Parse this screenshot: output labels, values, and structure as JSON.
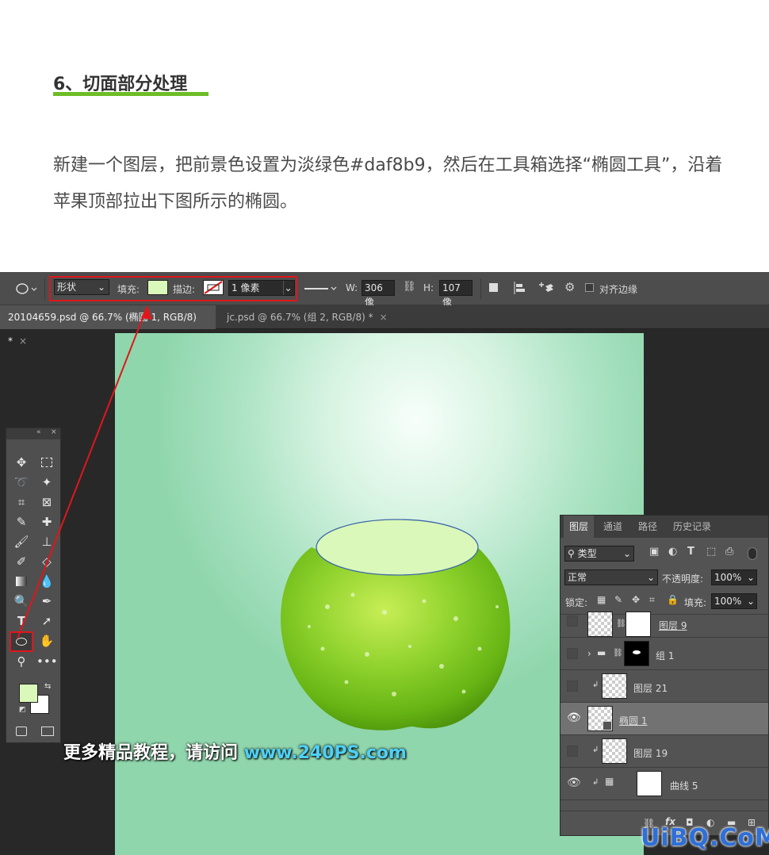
{
  "article": {
    "heading": "6、切面部分处理",
    "paragraph": "新建一个图层，把前景色设置为淡绿色#daf8b9，然后在工具箱选择“椭圆工具”，沿着苹果顶部拉出下图所示的椭圆。"
  },
  "options_bar": {
    "mode_select": "形状",
    "fill_label": "填充:",
    "fill_color": "#daf8b9",
    "stroke_label": "描边:",
    "stroke_width": "1 像素",
    "w_label": "W:",
    "w_value": "306 像",
    "h_label": "H:",
    "h_value": "107 像",
    "align_edges_label": "对齐边缘"
  },
  "tabs": [
    {
      "label": "20104659.psd @ 66.7% (椭圆 1, RGB/8) *",
      "close": "×"
    },
    {
      "label": "jc.psd @ 66.7% (组 2, RGB/8) *",
      "close": "×"
    }
  ],
  "annotation": {
    "watermark_text": "更多精品教程，请访问",
    "watermark_url": "www.240PS.com",
    "highlight_color": "#e0161b"
  },
  "layers_panel": {
    "tabs": [
      "图层",
      "通道",
      "路径",
      "历史记录"
    ],
    "filter_select": "类型",
    "blend_mode": "正常",
    "opacity_label": "不透明度:",
    "opacity_value": "100%",
    "lock_label": "锁定:",
    "fill_label": "填充:",
    "fill_value": "100%",
    "layers": [
      {
        "name": "图层 9"
      },
      {
        "name": "组 1"
      },
      {
        "name": "图层 21"
      },
      {
        "name": "椭圆 1"
      },
      {
        "name": "图层 19"
      },
      {
        "name": "曲线 5"
      }
    ],
    "footer_fx": "fx"
  },
  "corner_logo": "UiBQ.CoM",
  "colors": {
    "foreground": "#daf8b9",
    "background": "#ffffff",
    "ellipse_stroke": "#3f68a8",
    "ellipse_fill": "#daf8b9"
  }
}
